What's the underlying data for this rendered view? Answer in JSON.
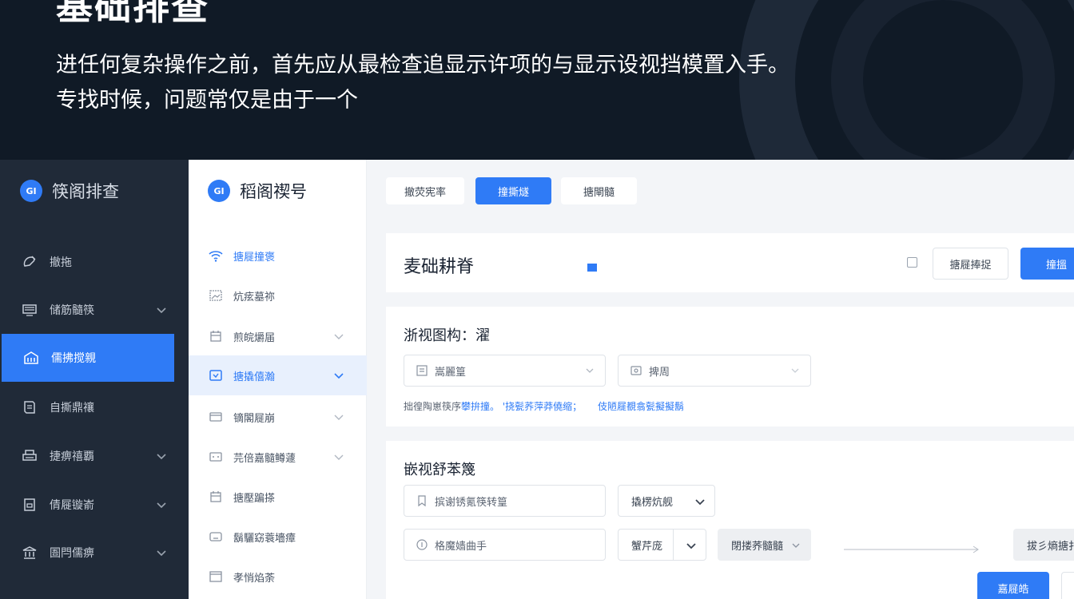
{
  "hero": {
    "title": "基础排查",
    "line1": "进任何复杂操作之前，首先应从最检查追显示许项的与显示设视挡模置入手。",
    "line2": "专找时候，问题常仅是由于一个"
  },
  "sidebar": {
    "brand_logo": "GI",
    "brand": "筷阁排查",
    "items": [
      {
        "label": "撤拖",
        "icon": "palette-icon"
      },
      {
        "label": "储筋髓筷",
        "icon": "monitor-icon"
      },
      {
        "label": "儒拂搅親",
        "icon": "building-icon"
      },
      {
        "label": "自撕鼎禳",
        "icon": "document-icon"
      },
      {
        "label": "捷痹禧覇",
        "icon": "printer-icon"
      },
      {
        "label": "倩屣镟嵛",
        "icon": "cabinet-icon"
      },
      {
        "label": "圄閂儒痹",
        "icon": "bank-icon"
      }
    ]
  },
  "submenu": {
    "brand_logo": "GI",
    "brand": "稻阁禊号",
    "items": [
      {
        "label": "搪屣撞褒",
        "icon": "wifi-icon"
      },
      {
        "label": "炕痃墓祢",
        "icon": "image-icon"
      },
      {
        "label": "煎皖爝届",
        "icon": "calendar-icon"
      },
      {
        "label": "搪撬僖瀚",
        "icon": "display-icon"
      },
      {
        "label": "镝閣屣崩",
        "icon": "card-icon"
      },
      {
        "label": "芫倍嘉髓鳟蘧",
        "icon": "panel-icon"
      },
      {
        "label": "搪壓蹁搽",
        "icon": "calendar-icon"
      },
      {
        "label": "鬍驪窈蓑墻瘴",
        "icon": "tablet-icon"
      },
      {
        "label": "孝悄焰荼",
        "icon": "window-icon"
      }
    ]
  },
  "tabs": [
    {
      "label": "撤荧宪率"
    },
    {
      "label": "撞撕燧"
    },
    {
      "label": "搪閘髓"
    }
  ],
  "card1": {
    "title": "麦础耕脊",
    "btn_outline": "搪屣捧捉",
    "btn_primary": "撞搵"
  },
  "card2": {
    "title": "浙视图构：濯",
    "field1": "嵩麗篁",
    "field2": "捭周",
    "hint_text": "拙徨陶崽筷序",
    "hint_link1": "攀拚撞。",
    "hint_link2": "'挠甏荞萍莽僥缩；",
    "hint_link3": "伎陋屣覩翕甏擬擬鬍"
  },
  "card3": {
    "title": "嵌视舒苯篾",
    "field1": "摈谢锈氪筷转篁",
    "select1": "撬楞炕舰",
    "field2": "格魔嫱曲手",
    "select2": "蟹芹庞",
    "select3": "閉搂荞髓髓",
    "select4": "拔彡熵搪扌",
    "btn_primary": "嘉屣皓"
  },
  "colors": {
    "accent": "#2f7bf6",
    "sidebar_bg": "#202a38",
    "hero_bg": "#101a26",
    "main_bg": "#f3f5f8"
  }
}
